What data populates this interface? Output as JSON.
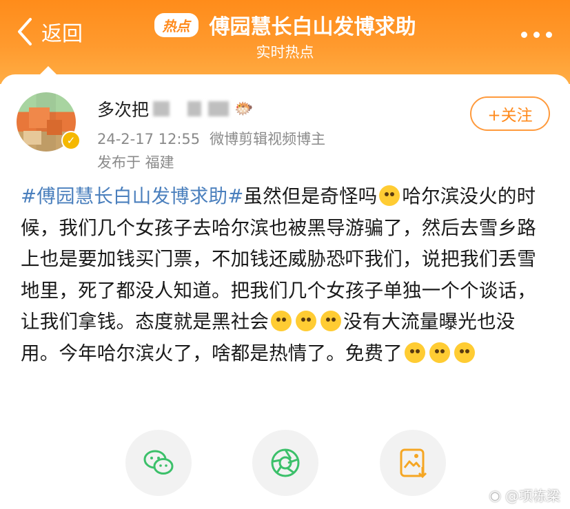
{
  "header": {
    "back_label": "返回",
    "badge": "热点",
    "title": "傅园慧长白山发博求助",
    "subtitle": "实时热点",
    "colors": {
      "accent": "#ff8c1a",
      "topic": "#4a7fbd"
    }
  },
  "author": {
    "name_visible": "多次把",
    "date": "24-2-17 12:55",
    "tag": "微博剪辑视频博主",
    "location": "发布于 福建",
    "follow_label": "+关注"
  },
  "post": {
    "topic": "#傅园慧长白山发博求助#",
    "seg1": "虽然但是奇怪吗",
    "seg2": "哈尔滨没火的时候，我们几个女孩子去哈尔滨也被黑导游骗了，然后去雪乡路上也是要加钱买门票，不加钱还威胁恐吓我们，说把我们丢雪地里，死了都没人知道。把我们几个女孩子单独一个个谈话，让我们拿钱。态度就是黑社会",
    "seg3": "没有大流量曝光也没用。今年哈尔滨火了，啥都是热情了。免费了"
  },
  "actions": {
    "icons": [
      "wechat-icon",
      "moments-icon",
      "save-image-icon"
    ]
  },
  "watermark": "@项栋梁"
}
